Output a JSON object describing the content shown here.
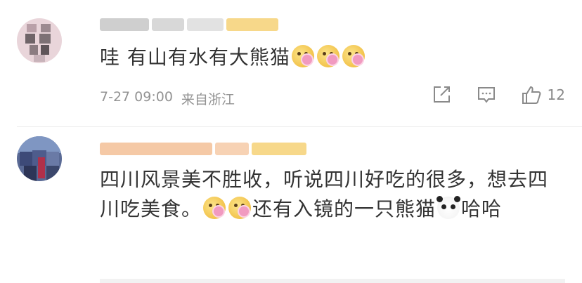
{
  "comments": [
    {
      "text_before_emoji": "哇 有山有水有大熊猫",
      "emoji_name": "flower-face-emoji",
      "emoji_count": 3,
      "timestamp": "7-27 09:00",
      "source": "来自浙江",
      "like_count": "12"
    },
    {
      "text_part1": "四川风景美不胜收，听说四川好吃的很多，想去四川吃美食。",
      "text_part2": "还有入镜的一只熊猫",
      "text_part3": "哈哈"
    }
  ],
  "colors": {
    "text": "#333333",
    "meta": "#939393",
    "icon": "#8a8a8a",
    "divider": "#ededed",
    "badge": "#f7d88a"
  },
  "icons": [
    "share-icon",
    "comment-icon",
    "like-icon",
    "panda-emoji",
    "flower-face-emoji"
  ]
}
